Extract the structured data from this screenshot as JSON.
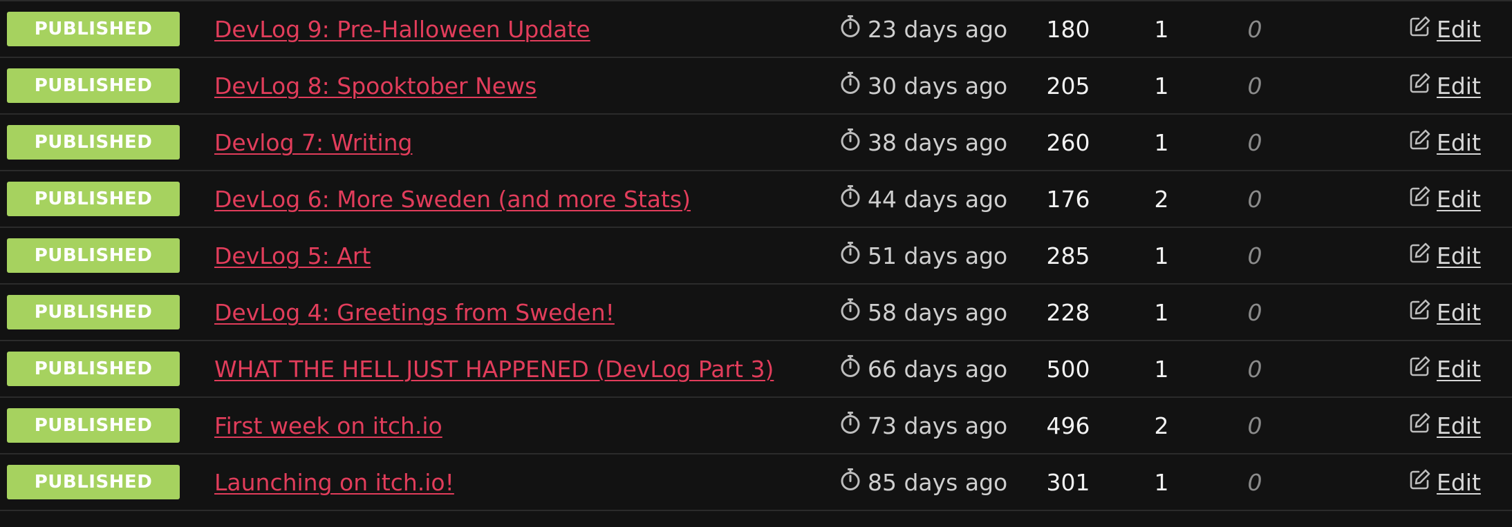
{
  "colors": {
    "background": "#121212",
    "badge": "#a6d25f",
    "link": "#e23d5b",
    "divider": "#2b2b2b"
  },
  "icons": {
    "time": "stopwatch-icon",
    "edit": "edit-icon"
  },
  "edit_label": "Edit",
  "posts": [
    {
      "status": "PUBLISHED",
      "title": "DevLog 9: Pre-Halloween Update",
      "published": "23 days ago",
      "views": "180",
      "likes": "1",
      "comments": "0"
    },
    {
      "status": "PUBLISHED",
      "title": "DevLog 8: Spooktober News",
      "published": "30 days ago",
      "views": "205",
      "likes": "1",
      "comments": "0"
    },
    {
      "status": "PUBLISHED",
      "title": "Devlog 7: Writing",
      "published": "38 days ago",
      "views": "260",
      "likes": "1",
      "comments": "0"
    },
    {
      "status": "PUBLISHED",
      "title": "DevLog 6: More Sweden (and more Stats)",
      "published": "44 days ago",
      "views": "176",
      "likes": "2",
      "comments": "0"
    },
    {
      "status": "PUBLISHED",
      "title": "DevLog 5: Art",
      "published": "51 days ago",
      "views": "285",
      "likes": "1",
      "comments": "0"
    },
    {
      "status": "PUBLISHED",
      "title": "DevLog 4: Greetings from Sweden!",
      "published": "58 days ago",
      "views": "228",
      "likes": "1",
      "comments": "0"
    },
    {
      "status": "PUBLISHED",
      "title": "WHAT THE HELL JUST HAPPENED (DevLog Part 3)",
      "published": "66 days ago",
      "views": "500",
      "likes": "1",
      "comments": "0"
    },
    {
      "status": "PUBLISHED",
      "title": "First week on itch.io",
      "published": "73 days ago",
      "views": "496",
      "likes": "2",
      "comments": "0"
    },
    {
      "status": "PUBLISHED",
      "title": "Launching on itch.io!",
      "published": "85 days ago",
      "views": "301",
      "likes": "1",
      "comments": "0"
    }
  ]
}
